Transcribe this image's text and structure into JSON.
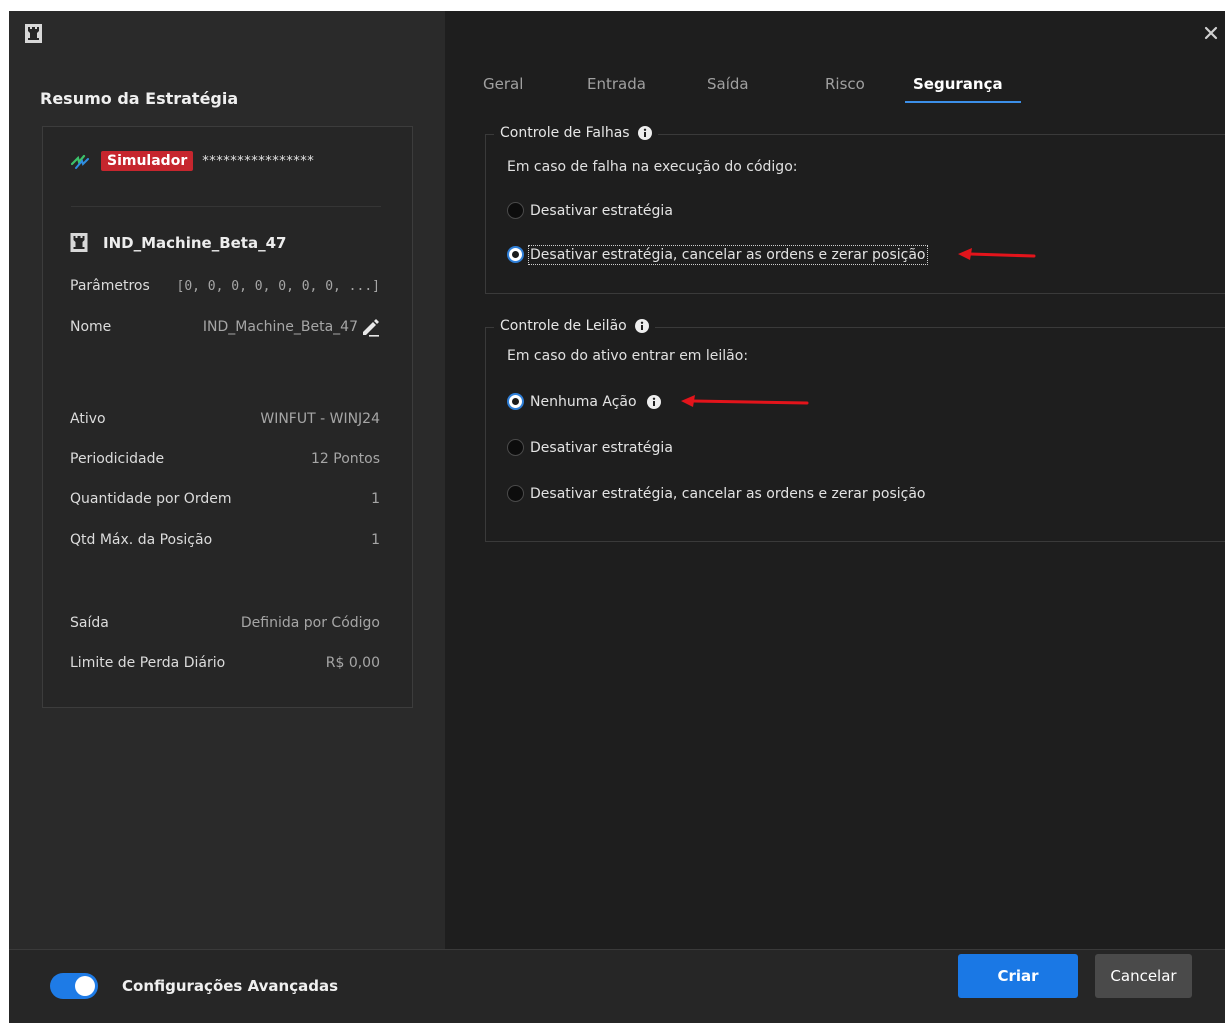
{
  "window": {
    "close_icon": "close-icon",
    "logo_icon": "rook-icon"
  },
  "sidebar": {
    "title": "Resumo da Estratégia",
    "connection_badge": "Simulador",
    "account_masked": "****************",
    "strategy_name": "IND_Machine_Beta_47",
    "rows": [
      {
        "label": "Parâmetros",
        "value": "[0, 0, 0, 0, 0, 0, 0, ...]"
      },
      {
        "label": "Nome",
        "value": "IND_Machine_Beta_47"
      },
      {
        "label": "Ativo",
        "value": "WINFUT - WINJ24"
      },
      {
        "label": "Periodicidade",
        "value": "12 Pontos"
      },
      {
        "label": "Quantidade por Ordem",
        "value": "1"
      },
      {
        "label": "Qtd Máx. da Posição",
        "value": "1"
      },
      {
        "label": "Saída",
        "value": "Definida por Código"
      },
      {
        "label": "Limite de Perda Diário",
        "value": "R$ 0,00"
      }
    ]
  },
  "tabs": [
    {
      "label": "Geral"
    },
    {
      "label": "Entrada"
    },
    {
      "label": "Saída"
    },
    {
      "label": "Risco"
    },
    {
      "label": "Segurança",
      "active": true
    }
  ],
  "falhas": {
    "title": "Controle de Falhas",
    "description": "Em caso de falha na execução do código:",
    "options": [
      {
        "label": "Desativar estratégia",
        "checked": false
      },
      {
        "label": "Desativar estratégia, cancelar as ordens e zerar posição",
        "checked": true
      }
    ]
  },
  "leilao": {
    "title": "Controle de Leilão",
    "description": "Em caso do ativo entrar em leilão:",
    "options": [
      {
        "label": "Nenhuma Ação",
        "checked": true
      },
      {
        "label": "Desativar estratégia",
        "checked": false
      },
      {
        "label": "Desativar estratégia, cancelar as ordens e zerar posição",
        "checked": false
      }
    ]
  },
  "footer": {
    "toggle_label": "Configurações Avançadas",
    "toggle_on": true,
    "primary_button": "Criar",
    "secondary_button": "Cancelar"
  },
  "colors": {
    "accent": "#1a78e5",
    "badge": "#c6262e",
    "annotation_arrow": "#e3141b"
  }
}
